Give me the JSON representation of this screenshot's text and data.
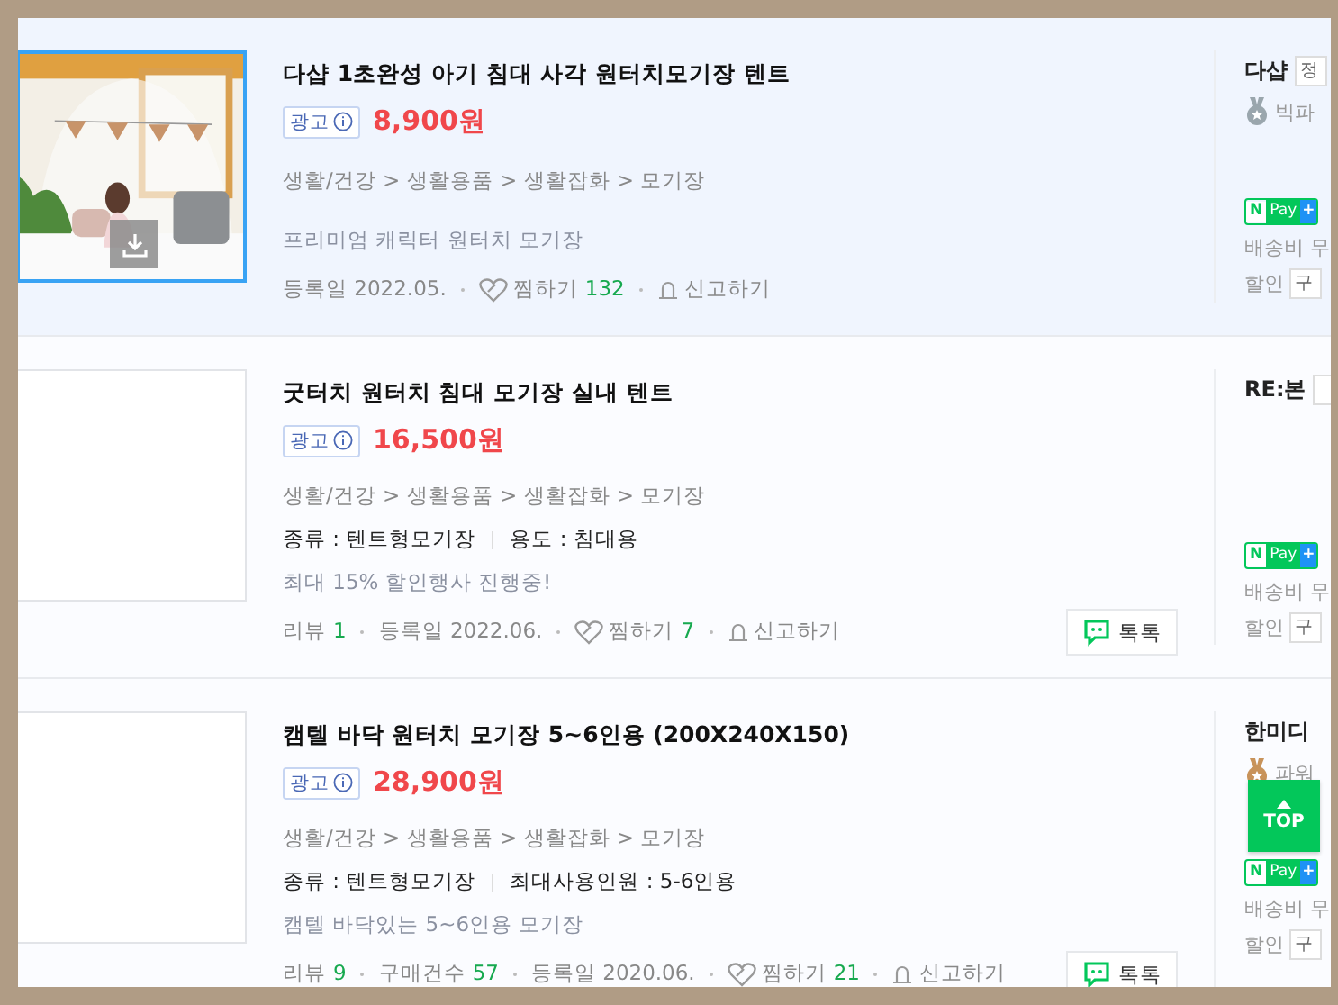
{
  "products": [
    {
      "selected": true,
      "image": {
        "kind": "picture"
      },
      "title": "다샵 1초완성 아기 침대 사각 원터치모기장 텐트",
      "ad": "광고",
      "price": "8,900원",
      "category": "생활/건강 > 생활용품 > 생활잡화 > 모기장",
      "description": "프리미엄 캐릭터 원터치 모기장",
      "meta": [
        {
          "label": "등록일 2022.05."
        }
      ],
      "wish": {
        "label": "찜하기",
        "count": "132"
      },
      "report": "신고하기",
      "seller": {
        "name": "다샵",
        "tag": "정",
        "grade": {
          "label": "빅파",
          "color": "#9aa6ad"
        },
        "npay": {
          "mark": "N",
          "label": "Pay",
          "plus": "+"
        },
        "shipping": "배송비 무",
        "discount": "할인",
        "discount_box": "구"
      }
    },
    {
      "selected": false,
      "image": {
        "kind": "empty"
      },
      "title": "굿터치 원터치 침대 모기장 실내 텐트",
      "ad": "광고",
      "price": "16,500원",
      "category": "생활/건강 > 생활용품 > 생활잡화 > 모기장",
      "specs": [
        "종류 : 텐트형모기장",
        "용도 : 침대용"
      ],
      "description": "최대 15% 할인행사 진행중!",
      "meta": [
        {
          "label": "리뷰",
          "count": "1"
        },
        {
          "label": "등록일 2022.06."
        }
      ],
      "wish": {
        "label": "찜하기",
        "count": "7"
      },
      "report": "신고하기",
      "talk": "톡톡",
      "seller": {
        "name": "RE:본",
        "tag_box": true,
        "npay": {
          "mark": "N",
          "label": "Pay",
          "plus": "+"
        },
        "shipping": "배송비 무",
        "discount": "할인",
        "discount_box": "구"
      }
    },
    {
      "selected": false,
      "image": {
        "kind": "empty"
      },
      "title": "캠텔 바닥 원터치 모기장 5~6인용 (200X240X150)",
      "ad": "광고",
      "price": "28,900원",
      "category": "생활/건강 > 생활용품 > 생활잡화 > 모기장",
      "specs": [
        "종류 : 텐트형모기장",
        "최대사용인원 : 5-6인용"
      ],
      "description": "캠텔 바닥있는 5~6인용 모기장",
      "meta": [
        {
          "label": "리뷰",
          "count": "9"
        },
        {
          "label": "구매건수",
          "count": "57"
        },
        {
          "label": "등록일 2020.06."
        }
      ],
      "wish": {
        "label": "찜하기",
        "count": "21"
      },
      "report": "신고하기",
      "talk": "톡톡",
      "seller": {
        "name": "한미디",
        "grade": {
          "label": "파워",
          "color": "#c8935a"
        },
        "npay": {
          "mark": "N",
          "label": "Pay",
          "plus": "+"
        },
        "shipping": "배송비 무",
        "discount": "할인",
        "discount_box": "구"
      }
    }
  ],
  "top_button": "TOP"
}
